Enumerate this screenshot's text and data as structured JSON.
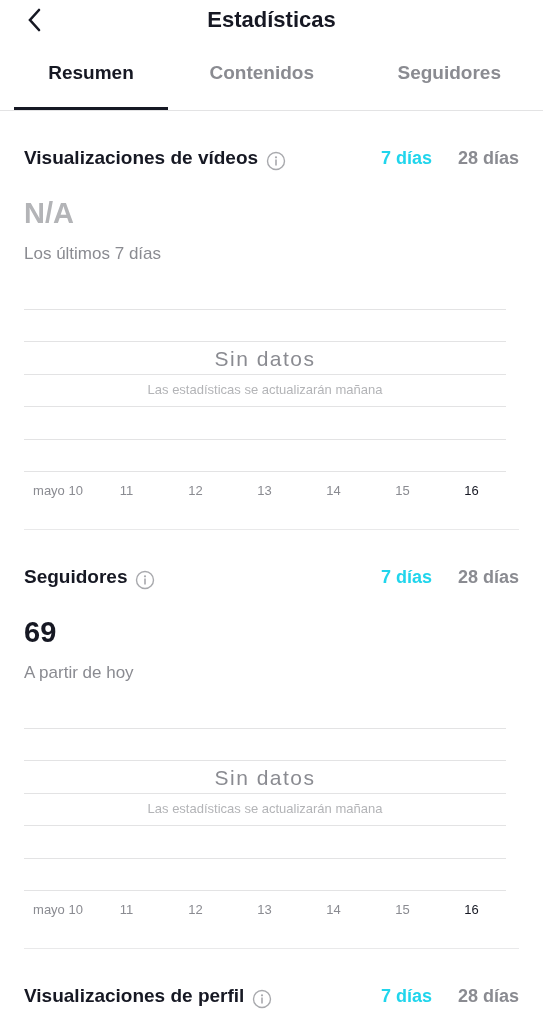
{
  "header": {
    "title": "Estadísticas"
  },
  "tabs": [
    {
      "label": "Resumen",
      "selected": true
    },
    {
      "label": "Contenidos",
      "selected": false
    },
    {
      "label": "Seguidores",
      "selected": false
    }
  ],
  "sections": [
    {
      "title": "Visualizaciones de vídeos",
      "periods": [
        {
          "label": "7 días",
          "selected": true
        },
        {
          "label": "28 días",
          "selected": false
        }
      ],
      "value": "N/A",
      "muted": true,
      "subtitle": "Los últimos 7 días",
      "chart": {
        "empty_title": "Sin datos",
        "empty_note": "Las estadísticas se actualizarán mañana",
        "x_labels": [
          {
            "text": "mayo 10",
            "today": false
          },
          {
            "text": "11",
            "today": false
          },
          {
            "text": "12",
            "today": false
          },
          {
            "text": "13",
            "today": false
          },
          {
            "text": "14",
            "today": false
          },
          {
            "text": "15",
            "today": false
          },
          {
            "text": "16",
            "today": true
          }
        ]
      }
    },
    {
      "title": "Seguidores",
      "periods": [
        {
          "label": "7 días",
          "selected": true
        },
        {
          "label": "28 días",
          "selected": false
        }
      ],
      "value": "69",
      "muted": false,
      "subtitle": "A partir de hoy",
      "chart": {
        "empty_title": "Sin datos",
        "empty_note": "Las estadísticas se actualizarán mañana",
        "x_labels": [
          {
            "text": "mayo 10",
            "today": false
          },
          {
            "text": "11",
            "today": false
          },
          {
            "text": "12",
            "today": false
          },
          {
            "text": "13",
            "today": false
          },
          {
            "text": "14",
            "today": false
          },
          {
            "text": "15",
            "today": false
          },
          {
            "text": "16",
            "today": true
          }
        ]
      }
    },
    {
      "title": "Visualizaciones de perfil",
      "periods": [
        {
          "label": "7 días",
          "selected": true
        },
        {
          "label": "28 días",
          "selected": false
        }
      ]
    }
  ]
}
